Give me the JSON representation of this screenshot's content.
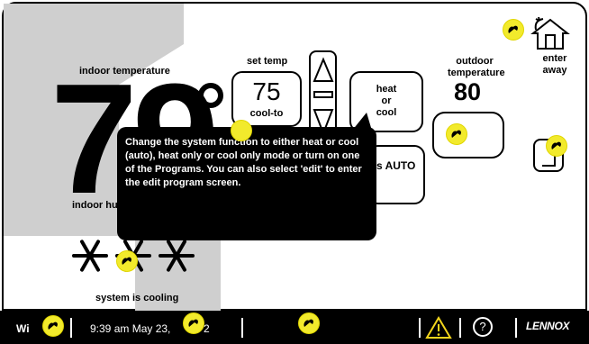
{
  "indoor": {
    "label": "indoor  temperature",
    "value": "79",
    "humidity_label": "indoor hu"
  },
  "set_temp": {
    "label": "set temp",
    "value": "75",
    "mode": "cool-to"
  },
  "system_mode": {
    "line1": "heat",
    "line2": "or",
    "line3": "cool"
  },
  "fan": {
    "label": "s AUTO"
  },
  "outdoor": {
    "label": "outdoor temperature",
    "value": "80"
  },
  "away": {
    "label": "enter away"
  },
  "status": {
    "text": "system is cooling"
  },
  "tooltip": {
    "text": "Change the system function to either heat or cool (auto), heat only or cool only mode or turn on one of the Programs. You can also select 'edit' to enter the edit program screen."
  },
  "bottom_bar": {
    "left_text": "Wi",
    "datetime": "9:39 am May 23,",
    "year_tail": "2",
    "brand": "LENNOX",
    "help": "?"
  },
  "colors": {
    "hint_marker": "#f2ea2c",
    "band": "#cfcfcf",
    "bar": "#000000"
  }
}
